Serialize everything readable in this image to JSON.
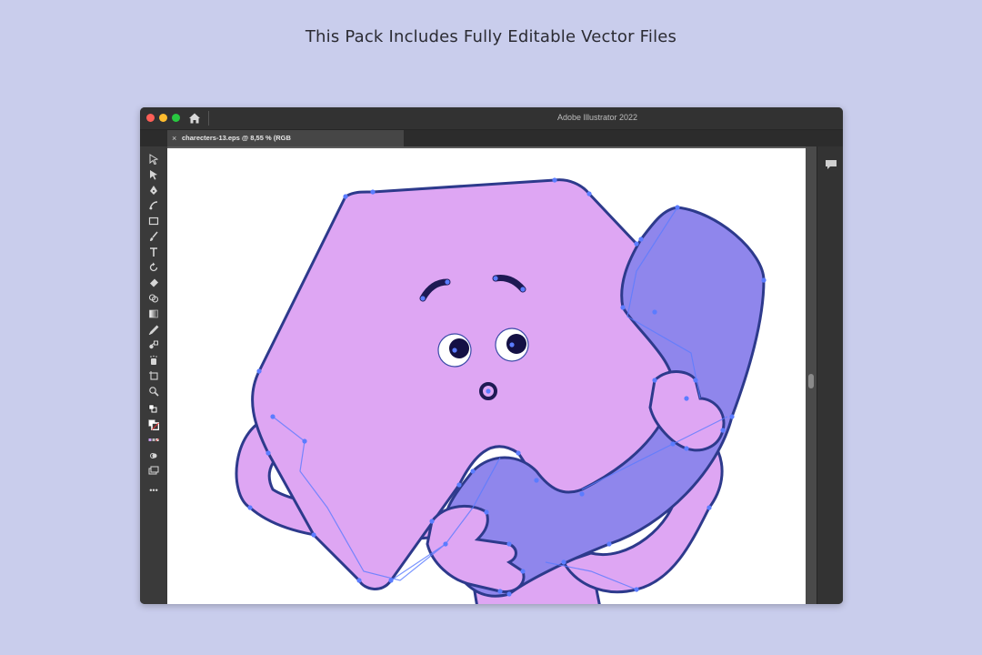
{
  "headline": "This Pack Includes Fully Editable Vector Files",
  "window": {
    "app_title": "Adobe Illustrator 2022",
    "document_tab": "charecters-13.eps @ 8,55 % (RGB",
    "close_glyph": "×"
  },
  "toolbar": {
    "tools": [
      "selection-tool",
      "direct-selection-tool",
      "pen-tool",
      "curvature-tool",
      "rectangle-tool",
      "paintbrush-tool",
      "type-tool",
      "rotate-tool",
      "eraser-tool",
      "shape-builder-tool",
      "gradient-tool",
      "eyedropper-tool",
      "blend-tool",
      "symbol-sprayer-tool",
      "artboard-tool",
      "zoom-tool"
    ],
    "more_label": "•••"
  },
  "colors": {
    "page_bg": "#c9cdec",
    "body_fill": "#dea6f3",
    "phone_fill": "#8f86ec",
    "outline": "#2d3a8c",
    "anchor": "#5b7cff"
  }
}
